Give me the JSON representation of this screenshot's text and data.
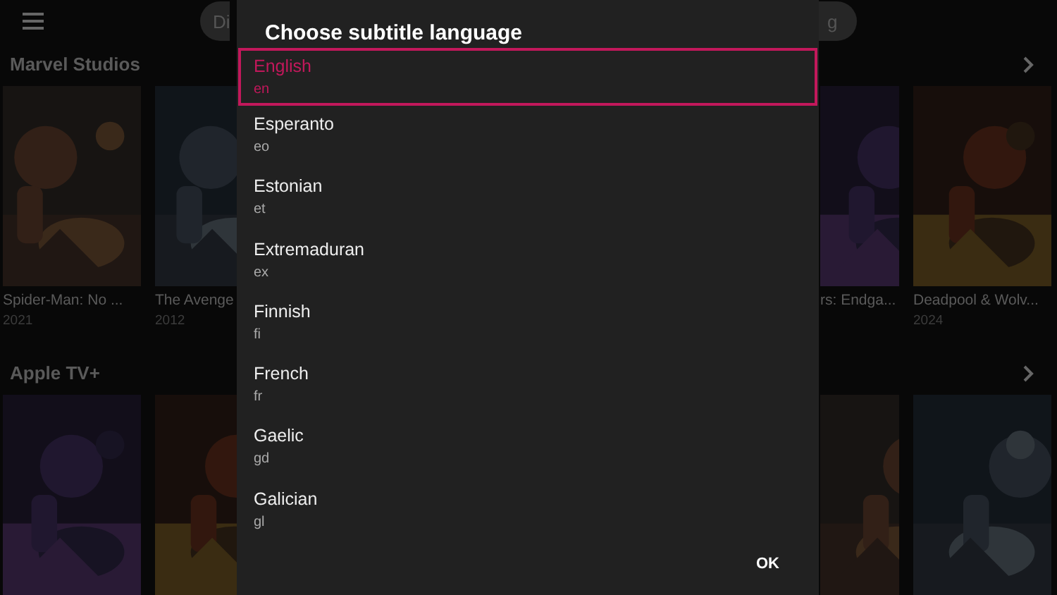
{
  "background": {
    "filter_pills": [
      {
        "label": "Di"
      },
      {
        "label": "g"
      }
    ],
    "sections": [
      {
        "title": "Marvel Studios",
        "movies": [
          {
            "kind": "movie",
            "title": "Spider-Man: No ...",
            "year": "2021"
          },
          {
            "kind": "movie",
            "title": "The Avenge",
            "year": "2012"
          },
          {
            "kind": "movie",
            "title": "rs: Endga..."
          },
          {
            "kind": "movie",
            "title": "Deadpool & Wolv...",
            "year": "2024"
          }
        ]
      },
      {
        "title": "Apple TV+"
      }
    ]
  },
  "dialog": {
    "title": "Choose subtitle language",
    "options": [
      {
        "name": "English",
        "code": "en",
        "selected": true
      },
      {
        "name": "Esperanto",
        "code": "eo",
        "selected": false
      },
      {
        "name": "Estonian",
        "code": "et",
        "selected": false
      },
      {
        "name": "Extremaduran",
        "code": "ex",
        "selected": false
      },
      {
        "name": "Finnish",
        "code": "fi",
        "selected": false
      },
      {
        "name": "French",
        "code": "fr",
        "selected": false
      },
      {
        "name": "Gaelic",
        "code": "gd",
        "selected": false
      },
      {
        "name": "Galician",
        "code": "gl",
        "selected": false
      }
    ],
    "button": "OK"
  }
}
